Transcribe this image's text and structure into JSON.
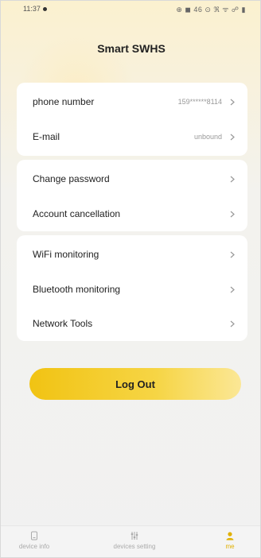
{
  "status_bar": {
    "time": "11:37",
    "icons_text": "⊕ ◼ 46 ⊙ ℜ ᯤ ☍ ▮"
  },
  "header": {
    "title": "Smart SWHS"
  },
  "account": {
    "phone_label": "phone number",
    "phone_value": "159******8114",
    "email_label": "E-mail",
    "email_value": "unbound"
  },
  "security": {
    "change_password_label": "Change password",
    "account_cancellation_label": "Account cancellation"
  },
  "tools": {
    "wifi_label": "WiFi monitoring",
    "bluetooth_label": "Bluetooth monitoring",
    "network_label": "Network Tools"
  },
  "logout": {
    "label": "Log Out"
  },
  "tab_bar": {
    "tabs": [
      {
        "label": "device info",
        "icon": "device-icon"
      },
      {
        "label": "devices setting",
        "icon": "settings-sliders-icon"
      },
      {
        "label": "me",
        "icon": "user-icon"
      }
    ],
    "active_index": 2
  },
  "colors": {
    "accent": "#f3c51c",
    "active_tab": "#e0b000"
  }
}
